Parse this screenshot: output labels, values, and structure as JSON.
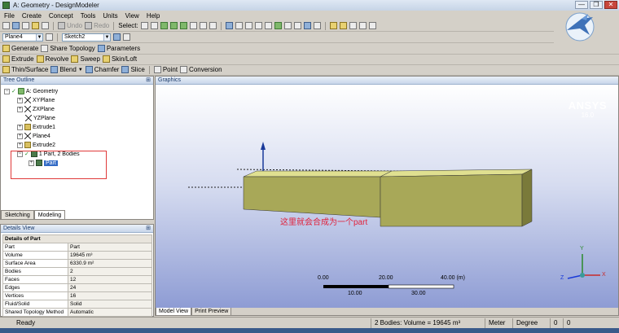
{
  "window": {
    "title": "A: Geometry - DesignModeler",
    "controls": [
      "—",
      "❐",
      "✕"
    ]
  },
  "menu": [
    "File",
    "Create",
    "Concept",
    "Tools",
    "Units",
    "View",
    "Help"
  ],
  "toolbar1": {
    "undo": "Undo",
    "redo": "Redo",
    "select_label": "Select:"
  },
  "toolbar2": {
    "plane_combo": "Plane4",
    "sketch_combo": "Sketch2"
  },
  "toolbar3": {
    "generate": "Generate",
    "share_topology": "Share Topology",
    "parameters": "Parameters"
  },
  "toolbar4": {
    "extrude": "Extrude",
    "revolve": "Revolve",
    "sweep": "Sweep",
    "skin_loft": "Skin/Loft"
  },
  "toolbar5": {
    "thin_surface": "Thin/Surface",
    "blend": "Blend",
    "chamfer": "Chamfer",
    "slice": "Slice",
    "point": "Point",
    "conversion": "Conversion"
  },
  "tree": {
    "header": "Tree Outline",
    "root": "A: Geometry",
    "items": [
      "XYPlane",
      "ZXPlane",
      "YZPlane",
      "Extrude1",
      "Plane4",
      "Extrude2"
    ],
    "bodies_node": "1 Part, 2 Bodies",
    "part_node": "Part"
  },
  "left_tabs": [
    "Sketching",
    "Modeling"
  ],
  "details": {
    "header": "Details View",
    "section": "Details of Part",
    "rows": [
      {
        "k": "Part",
        "v": "Part"
      },
      {
        "k": "Volume",
        "v": "19645 m³"
      },
      {
        "k": "Surface Area",
        "v": "6330.9 m²"
      },
      {
        "k": "Bodies",
        "v": "2"
      },
      {
        "k": "Faces",
        "v": "12"
      },
      {
        "k": "Edges",
        "v": "24"
      },
      {
        "k": "Vertices",
        "v": "16"
      },
      {
        "k": "Fluid/Solid",
        "v": "Solid"
      },
      {
        "k": "Shared Topology Method",
        "v": "Automatic"
      }
    ]
  },
  "graphics": {
    "header": "Graphics",
    "brand_name": "ANSYS",
    "brand_version": "16.0",
    "annotation": "这里就会合成为一个part",
    "scale_top": [
      "0.00",
      "20.00",
      "40.00 (m)"
    ],
    "scale_bottom": [
      "10.00",
      "30.00"
    ],
    "axis_y": "Y",
    "axis_x": "X",
    "axis_z": "Z",
    "bottom_tabs": [
      "Model View",
      "Print Preview"
    ]
  },
  "status": {
    "ready": "Ready",
    "selection": "2 Bodies: Volume = 19645 m³",
    "units": "Meter",
    "angle": "Degree",
    "v1": "0",
    "v2": "0"
  },
  "colors": {
    "body_top": "#e0e090",
    "body_front": "#a8a858",
    "body_side": "#7a7a3a",
    "annotation": "#e0203a"
  }
}
